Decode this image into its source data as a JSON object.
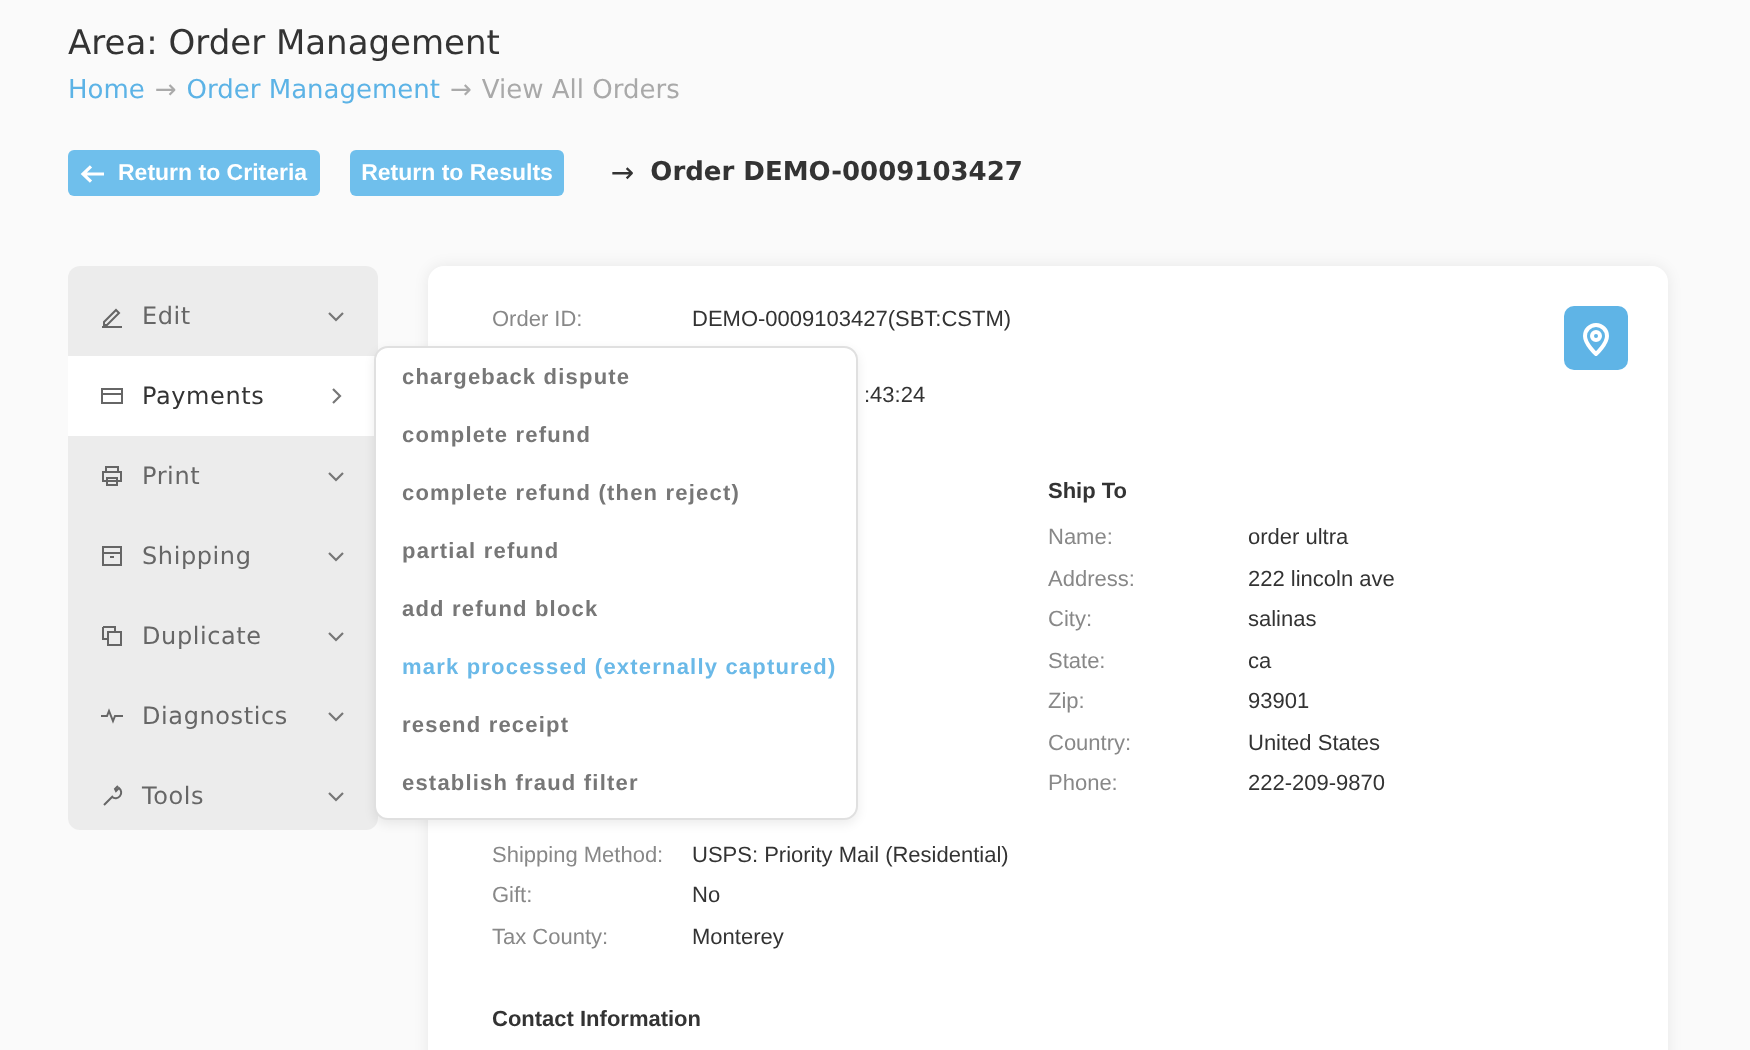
{
  "title": "Area: Order Management",
  "breadcrumb": [
    {
      "label": "Home",
      "link": true
    },
    {
      "label": "Order Management",
      "link": true
    },
    {
      "label": "View All Orders",
      "link": false
    }
  ],
  "breadcrumb_separator": "→",
  "actions": [
    {
      "label": "Return to Criteria",
      "arrow": true
    },
    {
      "label": "Return to Results",
      "arrow": false
    }
  ],
  "order_heading": {
    "arrow": "→",
    "text": "Order DEMO-0009103427"
  },
  "sidebar": {
    "items": [
      {
        "label": "Edit",
        "selected": false
      },
      {
        "label": "Payments",
        "selected": true
      },
      {
        "label": "Print",
        "selected": false
      },
      {
        "label": "Shipping",
        "selected": false
      },
      {
        "label": "Duplicate",
        "selected": false
      },
      {
        "label": "Diagnostics",
        "selected": false
      },
      {
        "label": "Tools",
        "selected": false
      }
    ]
  },
  "submenu": {
    "items": [
      {
        "label": "chargeback dispute",
        "selected": false
      },
      {
        "label": "complete refund",
        "selected": false
      },
      {
        "label": "complete refund (then reject)",
        "selected": false
      },
      {
        "label": "partial refund",
        "selected": false
      },
      {
        "label": "add refund block",
        "selected": false
      },
      {
        "label": "mark processed (externally captured)",
        "selected": true
      },
      {
        "label": "resend receipt",
        "selected": false
      },
      {
        "label": "establish fraud filter",
        "selected": false
      }
    ]
  },
  "order": {
    "rows": [
      {
        "label": "Order ID:",
        "value": "DEMO-0009103427(SBT:CSTM)"
      },
      {
        "label": "",
        "value": ":43:24"
      }
    ]
  },
  "ship_to": {
    "heading": "Ship To",
    "rows": [
      {
        "label": "Name:",
        "value": "order ultra"
      },
      {
        "label": "Address:",
        "value": "222 lincoln ave"
      },
      {
        "label": "City:",
        "value": "salinas"
      },
      {
        "label": "State:",
        "value": "ca"
      },
      {
        "label": "Zip:",
        "value": "93901"
      },
      {
        "label": "Country:",
        "value": "United States"
      },
      {
        "label": "Phone:",
        "value": "222-209-9870"
      }
    ]
  },
  "shipping": {
    "rows": [
      {
        "label": "Shipping Method:",
        "value": "USPS: Priority Mail (Residential)"
      },
      {
        "label": "Gift:",
        "value": "No"
      },
      {
        "label": "Tax County:",
        "value": "Monterey"
      }
    ]
  },
  "contact": {
    "heading": "Contact Information"
  }
}
